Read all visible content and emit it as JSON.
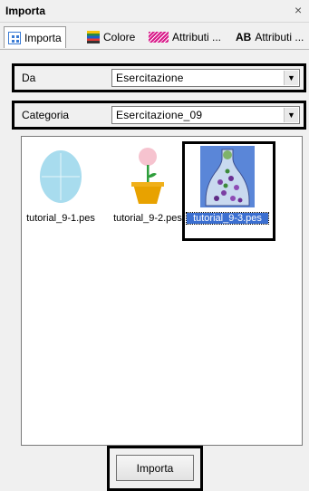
{
  "window": {
    "title": "Importa",
    "close_glyph": "×"
  },
  "tabs": [
    {
      "label": "Importa",
      "icon": "import-icon",
      "active": true
    },
    {
      "label": "Colore",
      "icon": "color-icon",
      "active": false
    },
    {
      "label": "Attributi ...",
      "icon": "thread-icon",
      "active": false
    },
    {
      "label": "Attributi ...",
      "icon_text": "AB",
      "icon": "text-attributes-icon",
      "active": false
    }
  ],
  "source": {
    "label": "Da",
    "value": "Esercitazione"
  },
  "category": {
    "label": "Categoria",
    "value": "Esercitazione_09"
  },
  "files": [
    {
      "name": "tutorial_9-1.pes",
      "selected": false,
      "thumb": "oval-design"
    },
    {
      "name": "tutorial_9-2.pes",
      "selected": false,
      "thumb": "flower-pot-design"
    },
    {
      "name": "tutorial_9-3.pes",
      "selected": true,
      "thumb": "bottle-design"
    }
  ],
  "actions": {
    "import_label": "Importa"
  },
  "colors": {
    "selection": "#3b6fd1",
    "oval": "#a8dcee",
    "flower": "#f6c3cf",
    "stem": "#2e9e3b",
    "pot": "#e8a200"
  }
}
